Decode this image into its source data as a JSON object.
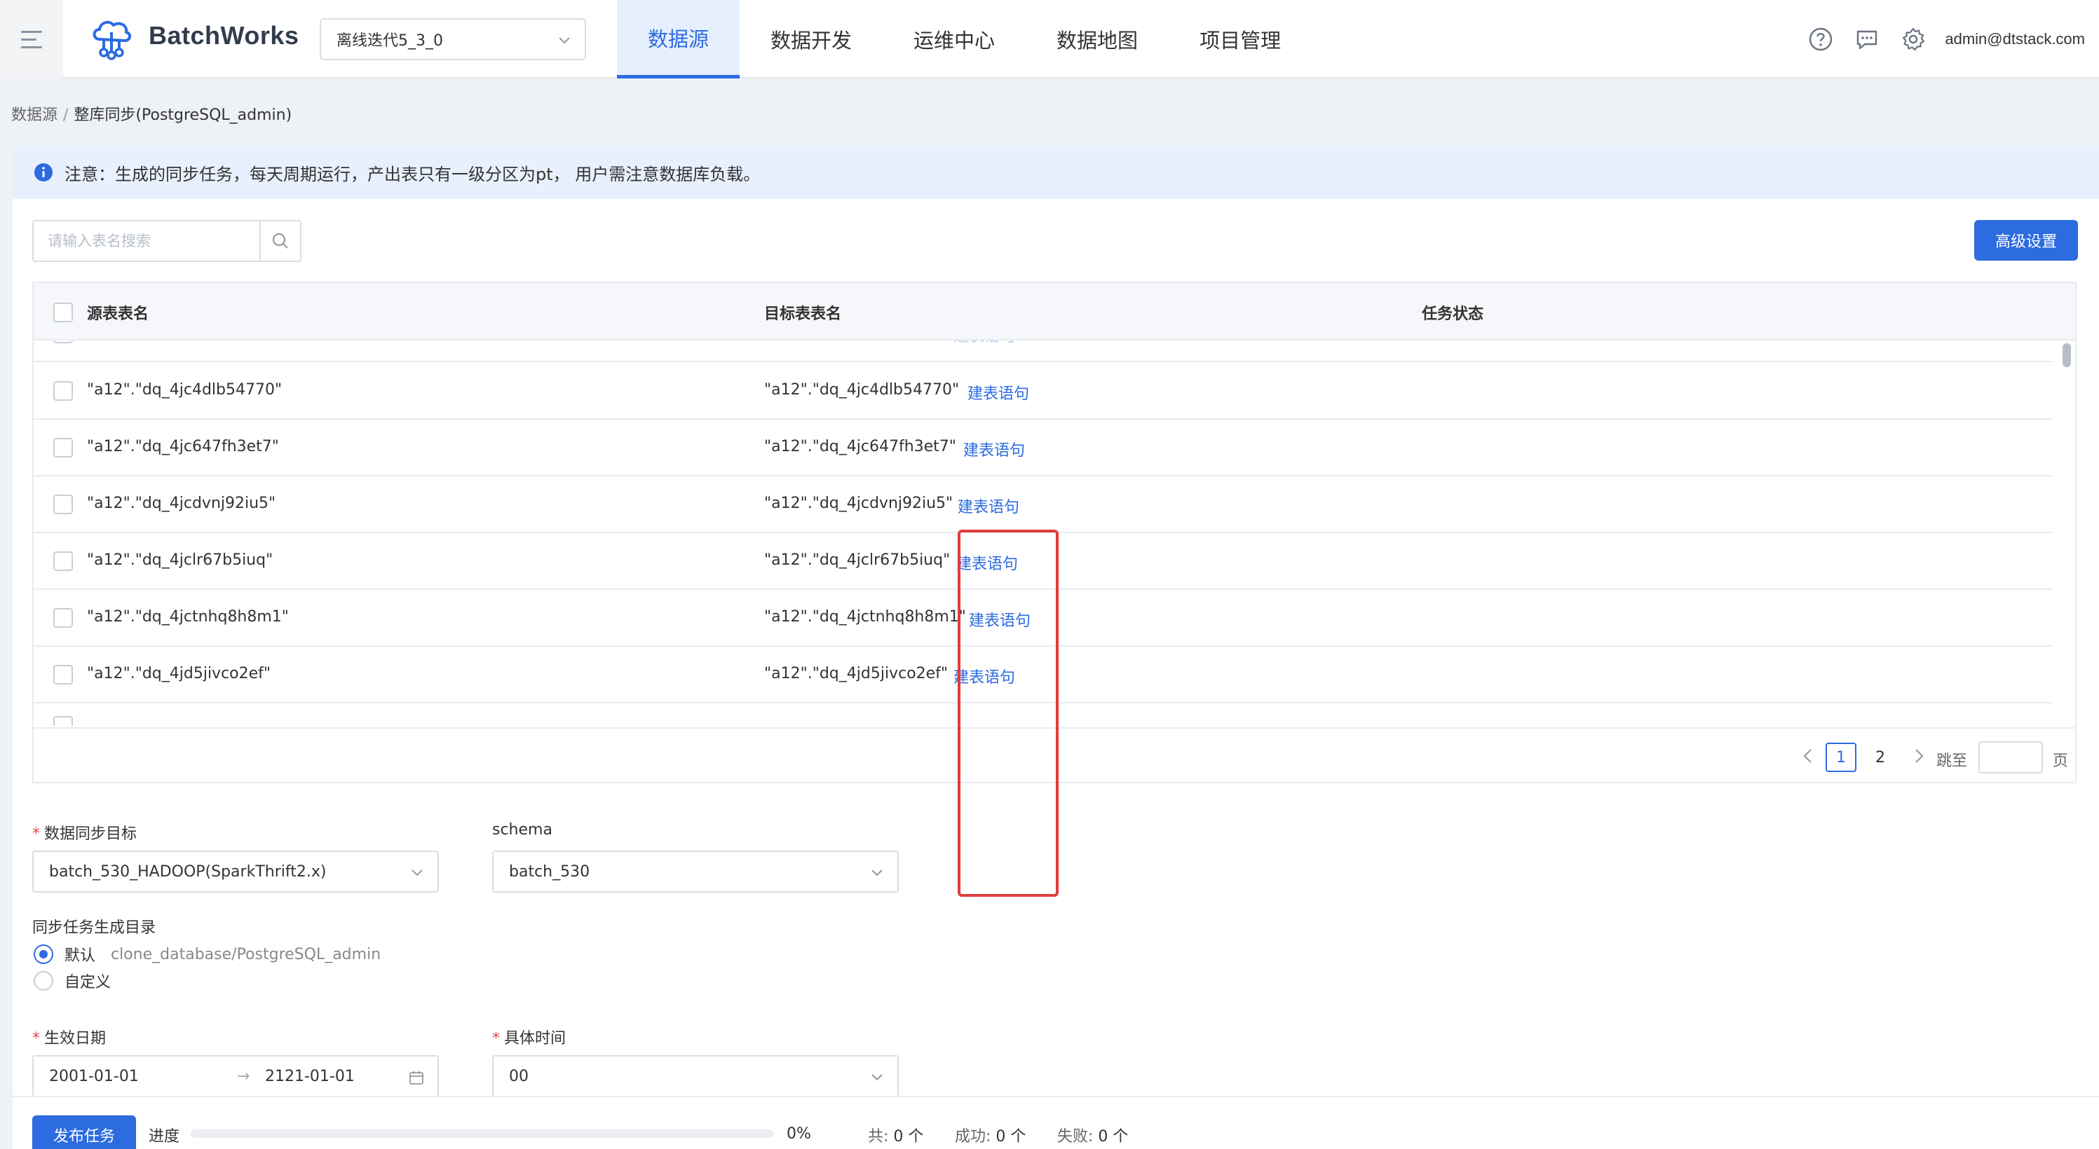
{
  "app": {
    "brand": "BatchWorks",
    "project": "离线迭代5_3_0",
    "user": "admin@dtstack.com"
  },
  "nav": [
    "数据源",
    "数据开发",
    "运维中心",
    "数据地图",
    "项目管理"
  ],
  "nav_active_index": 0,
  "breadcrumb": {
    "parent": "数据源",
    "separator": "/",
    "current": "整库同步(PostgreSQL_admin)"
  },
  "notice": "注意：生成的同步任务，每天周期运行，产出表只有一级分区为pt， 用户需注意数据库负载。",
  "search": {
    "placeholder": "请输入表名搜索",
    "value": ""
  },
  "advanced_button": "高级设置",
  "table": {
    "columns": [
      "源表表名",
      "目标表表名",
      "任务状态"
    ],
    "link_text": "建表语句",
    "rows": [
      {
        "source": "\"a12\".\"dq_4jc4dlb54770\"",
        "target": "\"a12\".\"dq_4jc4dlb54770\""
      },
      {
        "source": "\"a12\".\"dq_4jc647fh3et7\"",
        "target": "\"a12\".\"dq_4jc647fh3et7\""
      },
      {
        "source": "\"a12\".\"dq_4jcdvnj92iu5\"",
        "target": "\"a12\".\"dq_4jcdvnj92iu5\""
      },
      {
        "source": "\"a12\".\"dq_4jclr67b5iuq\"",
        "target": "\"a12\".\"dq_4jclr67b5iuq\""
      },
      {
        "source": "\"a12\".\"dq_4jctnhq8h8m1\"",
        "target": "\"a12\".\"dq_4jctnhq8h8m1\""
      },
      {
        "source": "\"a12\".\"dq_4jd5jivco2ef\"",
        "target": "\"a12\".\"dq_4jd5jivco2ef\""
      }
    ]
  },
  "pagination": {
    "pages": [
      "1",
      "2"
    ],
    "current": "1",
    "jump_label": "跳至",
    "jump_suffix": "页"
  },
  "form": {
    "target_label": "数据同步目标",
    "target_value": "batch_530_HADOOP(SparkThrift2.x)",
    "schema_label": "schema",
    "schema_value": "batch_530",
    "dir_label": "同步任务生成目录",
    "dir_default_label": "默认",
    "dir_default_path": "clone_database/PostgreSQL_admin",
    "dir_custom_label": "自定义",
    "date_label": "生效日期",
    "date_start": "2001-01-01",
    "date_arrow": "→",
    "date_end": "2121-01-01",
    "time_label": "具体时间",
    "time_value": "00",
    "required_mark": "*"
  },
  "footer": {
    "publish_button": "发布任务",
    "progress_label": "进度",
    "progress_value": 0,
    "progress_text": "0%",
    "total_label": "共:",
    "total_value": "0 个",
    "success_label": "成功:",
    "success_value": "0 个",
    "fail_label": "失败:",
    "fail_value": "0 个"
  },
  "colors": {
    "primary": "#2c6be0",
    "highlight_box": "#e03c3c",
    "notice_bg": "#e8f0fd"
  }
}
